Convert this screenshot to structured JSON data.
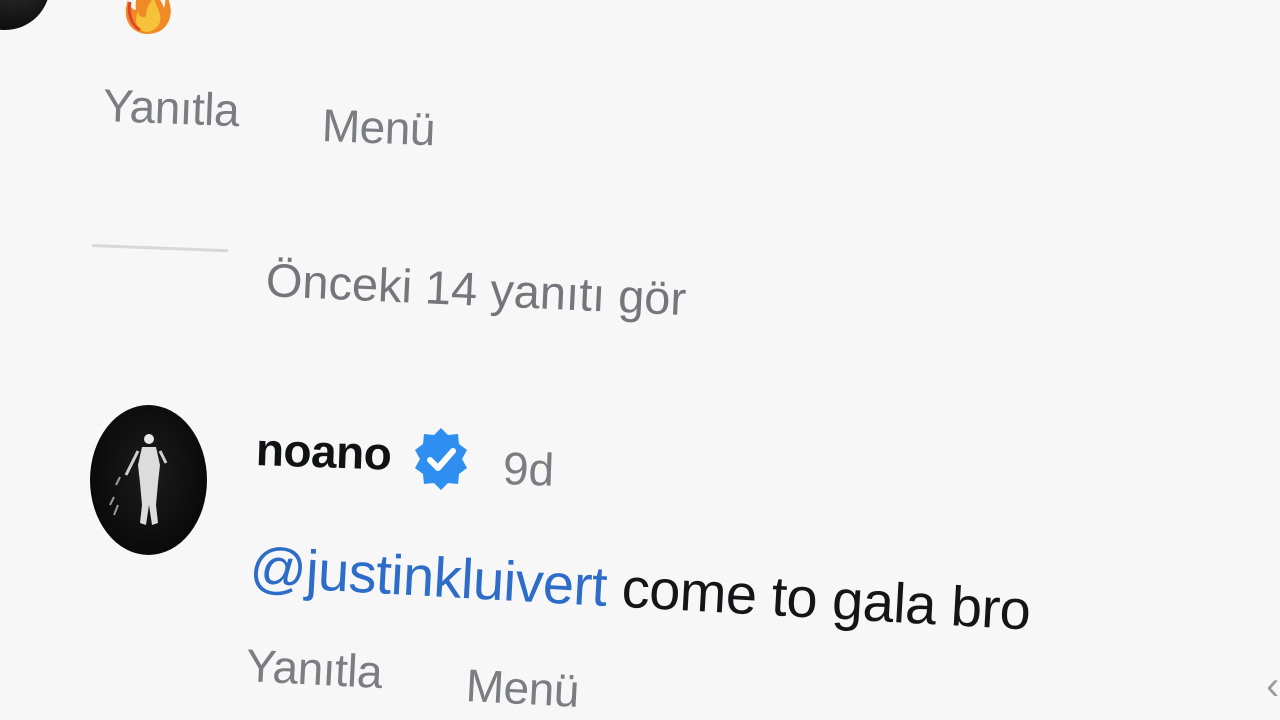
{
  "previous_comment": {
    "emoji_icon": "fire-icon",
    "reply_label": "Yanıtla",
    "menu_label": "Menü"
  },
  "thread": {
    "view_previous_label": "Önceki 14 yanıtı gör"
  },
  "comment": {
    "username": "noano",
    "verified_icon": "verified-badge-icon",
    "timestamp": "9d",
    "mention": "@justinkluivert",
    "text": " come to gala bro",
    "reply_label": "Yanıtla",
    "menu_label": "Menü"
  },
  "colors": {
    "background": "#f7f7f8",
    "mention": "#2d6cc9",
    "verified": "#2f8ff0",
    "secondary_text": "#7b7d82",
    "primary_text": "#111214"
  }
}
